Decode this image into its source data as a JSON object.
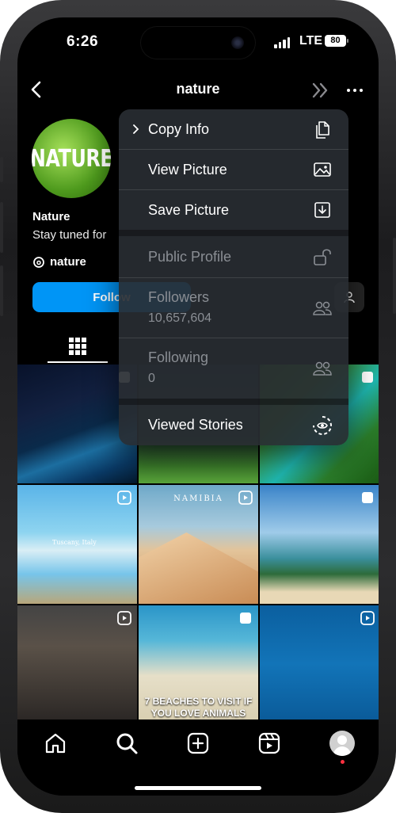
{
  "status": {
    "time": "6:26",
    "network": "LTE",
    "battery": "80"
  },
  "header": {
    "title": "nature"
  },
  "profile": {
    "avatar_text": "NATURE",
    "name": "Nature",
    "bio": "Stay tuned for",
    "threads_handle": "nature",
    "follow_label": "Follow"
  },
  "posts": [
    {
      "caption": ""
    },
    {
      "caption": ""
    },
    {
      "caption": ""
    },
    {
      "caption": "Tuscany, Italy"
    },
    {
      "caption": "NAMIBIA"
    },
    {
      "caption": ""
    },
    {
      "caption": ""
    },
    {
      "caption": "7 BEACHES TO VISIT IF YOU LOVE ANIMALS"
    },
    {
      "caption": ""
    }
  ],
  "menu": {
    "items": [
      {
        "label": "Copy Info",
        "icon": "copy-icon"
      },
      {
        "label": "View Picture",
        "icon": "image-icon"
      },
      {
        "label": "Save Picture",
        "icon": "download-icon"
      },
      {
        "label": "Public Profile",
        "icon": "unlock-icon"
      },
      {
        "label": "Followers",
        "value": "10,657,604",
        "icon": "people-icon"
      },
      {
        "label": "Following",
        "value": "0",
        "icon": "people-icon"
      },
      {
        "label": "Viewed Stories",
        "icon": "story-eye-icon"
      }
    ]
  },
  "colors": {
    "accent": "#0095f6",
    "menu_bg": "#2c3036"
  }
}
